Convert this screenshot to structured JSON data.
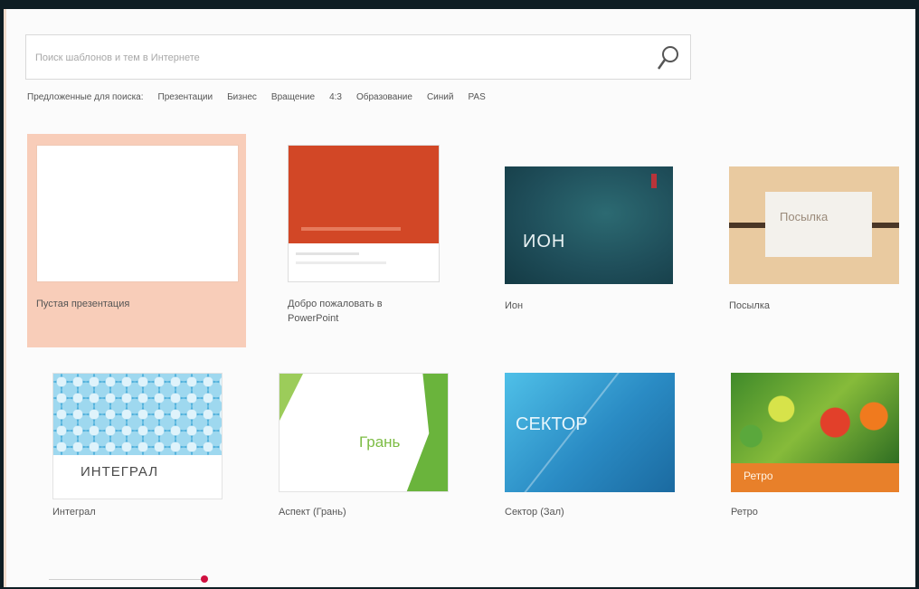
{
  "search": {
    "placeholder": "Поиск шаблонов и тем в Интернете",
    "value": ""
  },
  "categories": [
    "Предложенные для поиска:",
    "Презентации",
    "Бизнес",
    "Вращение",
    "4:3",
    "Образование",
    "Синий",
    "PAS"
  ],
  "templates": [
    {
      "label": "Пустая презентация",
      "thumb_text": ""
    },
    {
      "label": "Добро пожаловать в\nPowerPoint",
      "thumb_text": ""
    },
    {
      "label": "Ион",
      "thumb_text": "ИОН"
    },
    {
      "label": "Посылка",
      "thumb_text": "Посылка"
    },
    {
      "label": "Интеграл",
      "thumb_text": "ИНТЕГРАЛ"
    },
    {
      "label": "Аспект (Грань)",
      "thumb_text": "Грань"
    },
    {
      "label": "Сектор (Зал)",
      "thumb_text": "СЕКТОР"
    },
    {
      "label": "Ретро",
      "thumb_text": "Ретро"
    }
  ],
  "colors": {
    "accent_orange": "#d24726",
    "ion_teal": "#1f4e5a",
    "integral_blue": "#3aa5d6",
    "facet_green": "#6ab43c",
    "selected_bg": "#f8cdb9",
    "retro_orange": "#e8802a"
  }
}
